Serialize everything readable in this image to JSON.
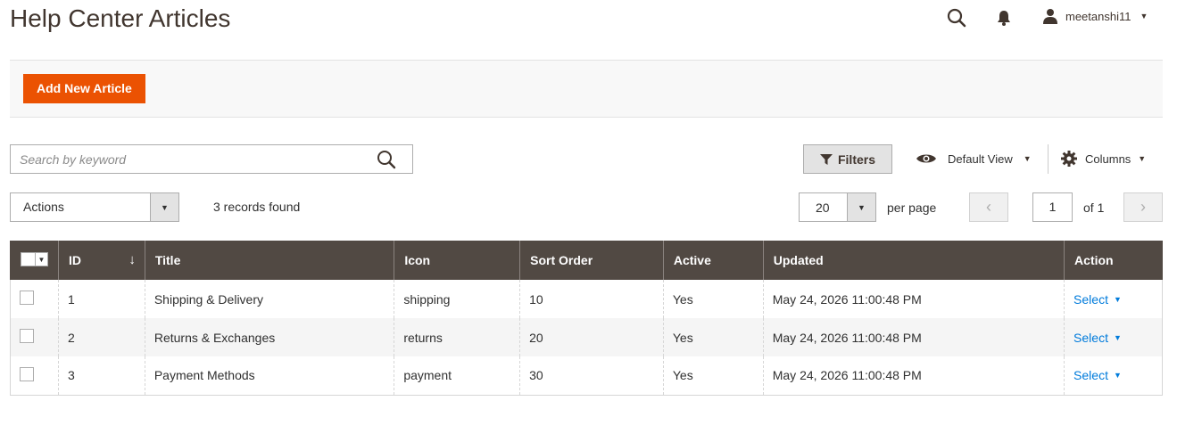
{
  "page": {
    "title": "Help Center Articles"
  },
  "header": {
    "username": "meetanshi11"
  },
  "toolbar": {
    "add_label": "Add New Article"
  },
  "search": {
    "placeholder": "Search by keyword"
  },
  "controls": {
    "filters_label": "Filters",
    "view_label": "Default View",
    "columns_label": "Columns",
    "actions_label": "Actions",
    "records_found": "3 records found",
    "per_page_value": "20",
    "per_page_label": "per page",
    "current_page": "1",
    "of_pages": "of 1"
  },
  "table": {
    "columns": [
      "ID",
      "Title",
      "Icon",
      "Sort Order",
      "Active",
      "Updated",
      "Action"
    ],
    "rows": [
      {
        "id": "1",
        "title": "Shipping & Delivery",
        "icon": "shipping",
        "sort_order": "10",
        "active": "Yes",
        "updated": "May 24, 2026 11:00:48 PM",
        "action": "Select"
      },
      {
        "id": "2",
        "title": "Returns & Exchanges",
        "icon": "returns",
        "sort_order": "20",
        "active": "Yes",
        "updated": "May 24, 2026 11:00:48 PM",
        "action": "Select"
      },
      {
        "id": "3",
        "title": "Payment Methods",
        "icon": "payment",
        "sort_order": "30",
        "active": "Yes",
        "updated": "May 24, 2026 11:00:48 PM",
        "action": "Select"
      }
    ]
  },
  "colors": {
    "accent": "#eb5202",
    "table_header": "#514943",
    "link": "#007bdb"
  }
}
